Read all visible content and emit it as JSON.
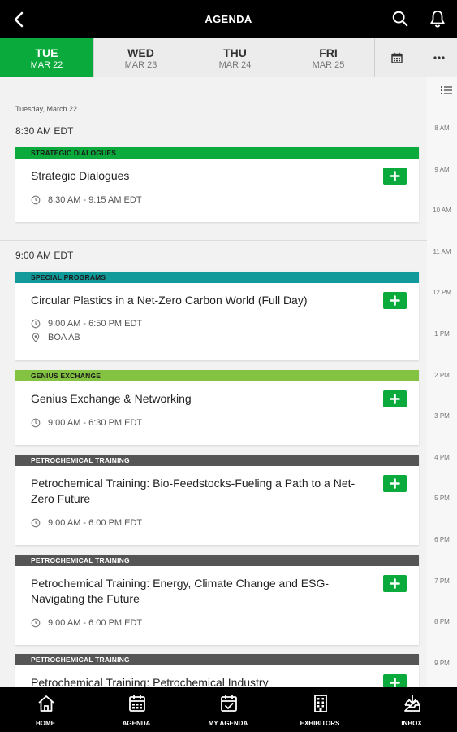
{
  "header": {
    "title": "AGENDA"
  },
  "days": [
    {
      "dow": "TUE",
      "date": "MAR 22"
    },
    {
      "dow": "WED",
      "date": "MAR 23"
    },
    {
      "dow": "THU",
      "date": "MAR 24"
    },
    {
      "dow": "FRI",
      "date": "MAR 25"
    }
  ],
  "active_day": "TUE",
  "day_label": "Tuesday, March 22",
  "time_groups": [
    {
      "label": "8:30 AM EDT"
    },
    {
      "label": "9:00 AM EDT"
    }
  ],
  "sessions": [
    {
      "category": "STRATEGIC DIALOGUES",
      "color": "#0aaa3c",
      "title": "Strategic Dialogues",
      "time": "8:30 AM - 9:15 AM EDT"
    },
    {
      "category": "SPECIAL PROGRAMS",
      "color": "#12999a",
      "title": "Circular Plastics in a Net-Zero Carbon World (Full Day)",
      "time": "9:00 AM - 6:50 PM EDT",
      "location": "BOA AB"
    },
    {
      "category": "GENIUS EXCHANGE",
      "color": "#84c341",
      "title": "Genius Exchange & Networking",
      "time": "9:00 AM - 6:30 PM EDT"
    },
    {
      "category": "PETROCHEMICAL TRAINING",
      "color": "#555555",
      "title": "Petrochemical Training: Bio-Feedstocks-Fueling a Path to a Net-Zero Future",
      "time": "9:00 AM - 6:00 PM EDT"
    },
    {
      "category": "PETROCHEMICAL TRAINING",
      "color": "#555555",
      "title": "Petrochemical Training: Energy, Climate Change and ESG- Navigating the Future",
      "time": "9:00 AM - 6:00 PM EDT"
    },
    {
      "category": "PETROCHEMICAL TRAINING",
      "color": "#555555",
      "title": "Petrochemical Training: Petrochemical Industry"
    }
  ],
  "timeline_hours": [
    "8 AM",
    "9 AM",
    "10 AM",
    "11 AM",
    "12 PM",
    "1 PM",
    "2 PM",
    "3 PM",
    "4 PM",
    "5 PM",
    "6 PM",
    "7 PM",
    "8 PM",
    "9 PM"
  ],
  "nav": [
    {
      "label": "HOME",
      "icon": "home-icon"
    },
    {
      "label": "AGENDA",
      "icon": "calendar-icon"
    },
    {
      "label": "MY AGENDA",
      "icon": "calendar-check-icon"
    },
    {
      "label": "EXHIBITORS",
      "icon": "building-icon"
    },
    {
      "label": "INBOX",
      "icon": "inbox-icon"
    }
  ],
  "colors": {
    "accent": "#0aaa3c",
    "bar": "#000000"
  }
}
